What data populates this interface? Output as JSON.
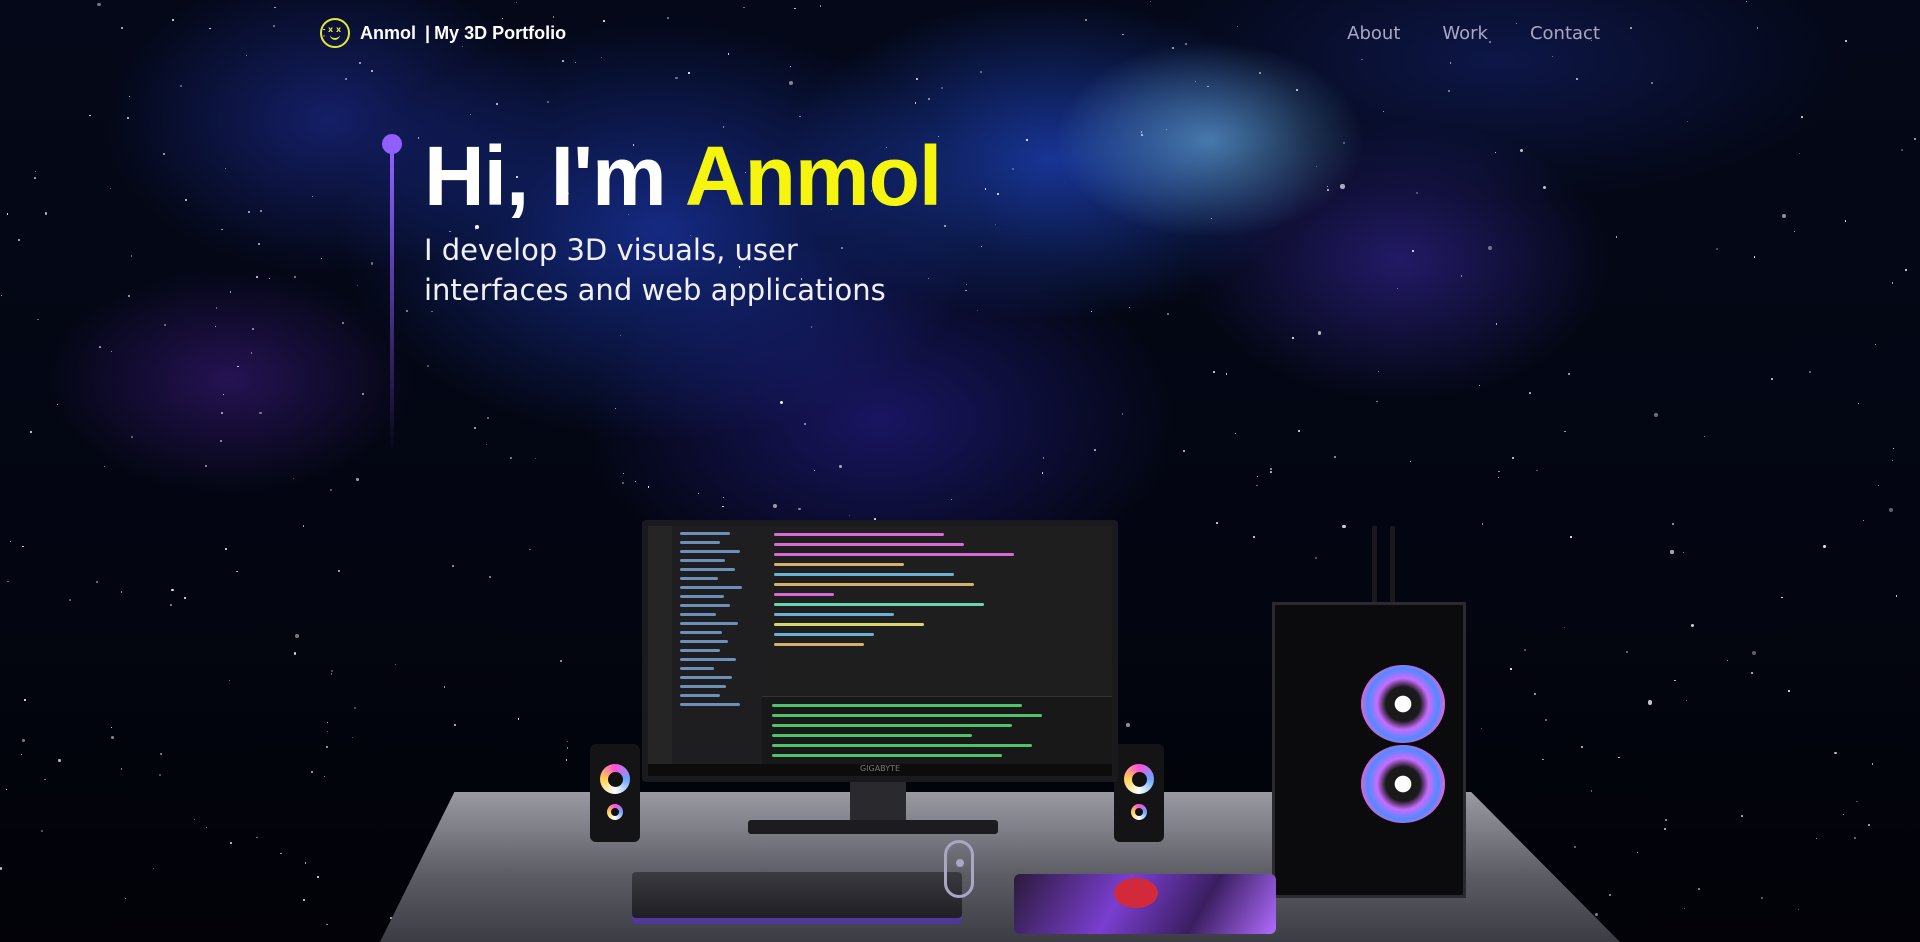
{
  "nav": {
    "brand_name": "Anmol",
    "brand_separator": "|",
    "brand_tagline": "My 3D Portfolio",
    "links": [
      "About",
      "Work",
      "Contact"
    ]
  },
  "hero": {
    "greeting": "Hi, I'm",
    "name": "Anmol",
    "subtitle_line1": "I develop 3D visuals, user",
    "subtitle_line2": "interfaces and web applications"
  },
  "scene": {
    "monitor_brand": "GIGABYTE"
  },
  "colors": {
    "accent_purple": "#915eff",
    "name_yellow": "#f5f50f",
    "nav_link": "#aaa6c3"
  },
  "icons": {
    "logo": "smiley-logo-icon",
    "scroll": "scroll-down-icon"
  }
}
